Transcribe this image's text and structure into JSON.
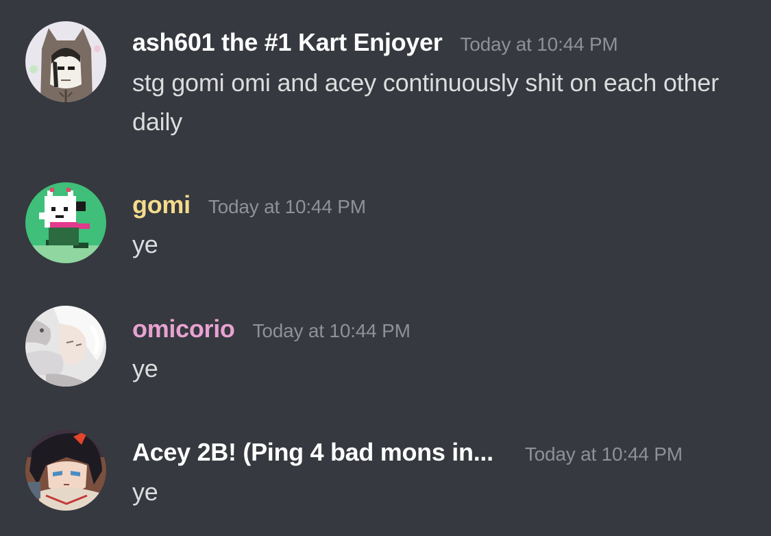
{
  "messages": [
    {
      "username": "ash601 the #1 Kart Enjoyer",
      "username_color": "#ffffff",
      "timestamp": "Today at 10:44 PM",
      "text": "stg gomi omi and acey continuously shit on each other daily"
    },
    {
      "username": "gomi",
      "username_color": "#f4dc8c",
      "timestamp": "Today at 10:44 PM",
      "text": "ye"
    },
    {
      "username": "omicorio",
      "username_color": "#e8a2d2",
      "timestamp": "Today at 10:44 PM",
      "text": "ye"
    },
    {
      "username": "Acey 2B! (Ping 4 bad mons in...",
      "username_color": "#ffffff",
      "timestamp": "Today at 10:44 PM",
      "text": "ye"
    }
  ],
  "colors": {
    "background": "#36393f",
    "message_text": "#dcddde",
    "timestamp": "#8e9297"
  }
}
